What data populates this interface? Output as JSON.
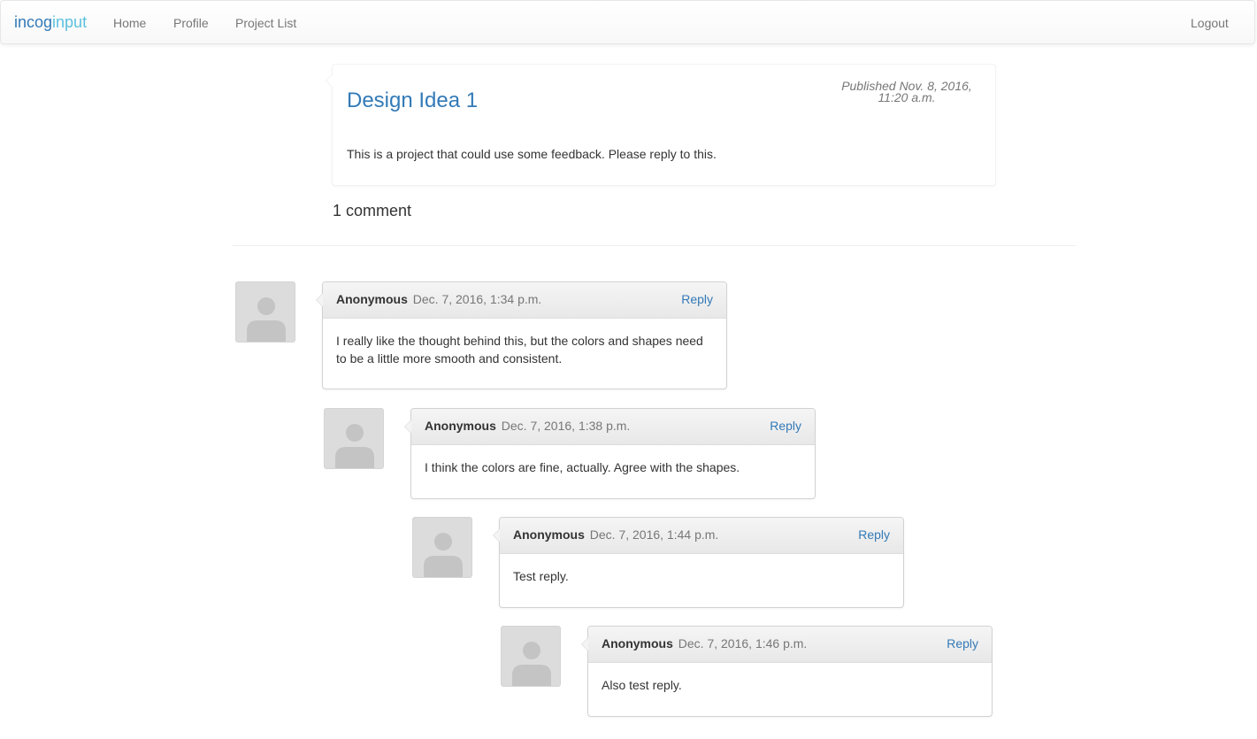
{
  "navbar": {
    "brand_part1": "incog",
    "brand_part2": "input",
    "links": [
      "Home",
      "Profile",
      "Project List"
    ],
    "logout": "Logout"
  },
  "post": {
    "title": "Design Idea 1",
    "published_line1": "Published Nov. 8, 2016,",
    "published_line2": "11:20 a.m.",
    "body": "This is a project that could use some feedback. Please reply to this."
  },
  "comment_count": "1 comment",
  "comments": [
    {
      "author": "Anonymous",
      "date": "Dec. 7, 2016, 1:34 p.m.",
      "reply_label": "Reply",
      "body": "I really like the thought behind this, but the colors and shapes need to be a little more smooth and consistent."
    },
    {
      "author": "Anonymous",
      "date": "Dec. 7, 2016, 1:38 p.m.",
      "reply_label": "Reply",
      "body": "I think the colors are fine, actually. Agree with the shapes."
    },
    {
      "author": "Anonymous",
      "date": "Dec. 7, 2016, 1:44 p.m.",
      "reply_label": "Reply",
      "body": "Test reply."
    },
    {
      "author": "Anonymous",
      "date": "Dec. 7, 2016, 1:46 p.m.",
      "reply_label": "Reply",
      "body": "Also test reply."
    }
  ],
  "icons": {
    "avatar": "user-silhouette-icon",
    "post_pointer": "panel-arrow-icon"
  },
  "colors": {
    "link": "#337ab7",
    "brand_accent": "#5bc0de",
    "muted": "#777777",
    "text": "#333333"
  }
}
